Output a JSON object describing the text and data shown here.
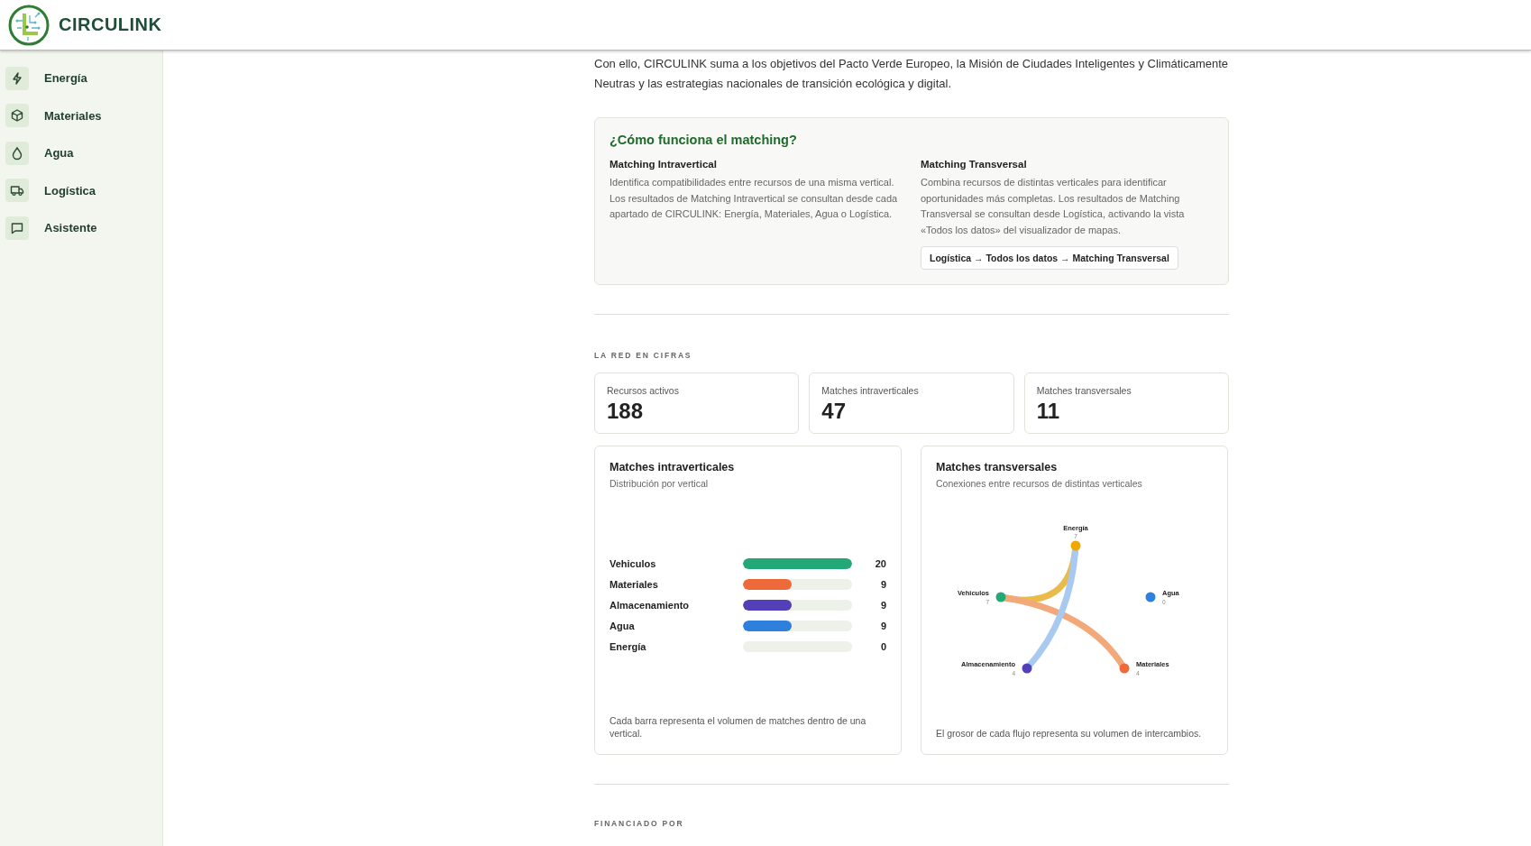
{
  "brand": {
    "name": "CIRCULINK"
  },
  "sidebar": {
    "items": [
      {
        "label": "Energía",
        "kind": "bolt"
      },
      {
        "label": "Materiales",
        "kind": "cube"
      },
      {
        "label": "Agua",
        "kind": "drop"
      },
      {
        "label": "Logística",
        "kind": "truck"
      },
      {
        "label": "Asistente",
        "kind": "chat"
      }
    ]
  },
  "intro": "Con ello, CIRCULINK suma a los objetivos del Pacto Verde Europeo, la Misión de Ciudades Inteligentes y Climáticamente Neutras y las estrategias nacionales de transición ecológica y digital.",
  "matching": {
    "title": "¿Cómo funciona el matching?",
    "columns": [
      {
        "title": "Matching Intravertical",
        "text": "Identifica compatibilidades entre recursos de una misma vertical. Los resultados de Matching Intravertical se consultan desde cada apartado de CIRCULINK: Energía, Materiales, Agua o Logística."
      },
      {
        "title": "Matching Transversal",
        "text": "Combina recursos de distintas verticales para identificar oportunidades más completas. Los resultados de Matching Transversal se consultan desde Logística, activando la vista «Todos los datos» del visualizador de mapas.",
        "path": "Logística → Todos los datos → Matching Transversal"
      }
    ]
  },
  "stats": {
    "heading": "LA RED EN CIFRAS",
    "cards": [
      {
        "label": "Recursos activos",
        "value": "188"
      },
      {
        "label": "Matches intraverticales",
        "value": "47"
      },
      {
        "label": "Matches transversales",
        "value": "11"
      }
    ]
  },
  "intra": {
    "title": "Matches intraverticales",
    "subtitle": "Distribución por vertical",
    "bars": [
      {
        "label": "Vehiculos",
        "value": "20",
        "level": 1,
        "color": "#23a878"
      },
      {
        "label": "Materiales",
        "value": "9",
        "level": 0.45,
        "color": "#ee6a3a"
      },
      {
        "label": "Almacenamiento",
        "value": "9",
        "level": 0.45,
        "color": "#5340b8"
      },
      {
        "label": "Agua",
        "value": "9",
        "level": 0.45,
        "color": "#2f80dc"
      },
      {
        "label": "Energía",
        "value": "0"
      }
    ],
    "note": "Cada barra representa el volumen de matches dentro de una vertical."
  },
  "trans": {
    "title": "Matches transversales",
    "subtitle": "Conexiones entre recursos de distintas verticales",
    "nodes": [
      {
        "name": "Energía",
        "count": "7",
        "color": "#f0a800"
      },
      {
        "name": "Vehiculos",
        "count": "7",
        "color": "#23a878"
      },
      {
        "name": "Agua",
        "count": "0",
        "color": "#2f80dc"
      },
      {
        "name": "Almacenamiento",
        "count": "4",
        "color": "#5340b8"
      },
      {
        "name": "Materiales",
        "count": "4",
        "color": "#ee6a3a"
      }
    ],
    "links": [
      {
        "color": "#e9bb4a"
      },
      {
        "color": "#f2a878"
      },
      {
        "color": "#a8c9f0"
      }
    ],
    "note": "El grosor de cada flujo representa su volumen de intercambios."
  },
  "funding": {
    "heading": "FINANCIADO POR"
  }
}
